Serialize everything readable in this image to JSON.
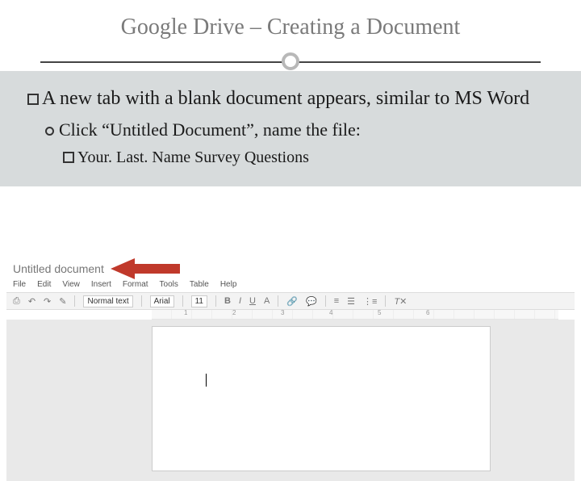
{
  "title": "Google Drive – Creating a Document",
  "bullets": {
    "l1": "A new tab with a blank document appears, similar to MS Word",
    "l2": "Click “Untitled Document”, name the file:",
    "l3": "Your. Last. Name Survey Questions"
  },
  "docs": {
    "title": "Untitled document",
    "menus": [
      "File",
      "Edit",
      "View",
      "Insert",
      "Format",
      "Tools",
      "Table",
      "Help"
    ],
    "toolbar": {
      "style_select": "Normal text",
      "font_select": "Arial",
      "font_size": "11",
      "buttons": [
        "B",
        "I",
        "U",
        "A"
      ],
      "ruler_numbers": [
        "1",
        "2",
        "3",
        "4",
        "5",
        "6"
      ]
    }
  }
}
